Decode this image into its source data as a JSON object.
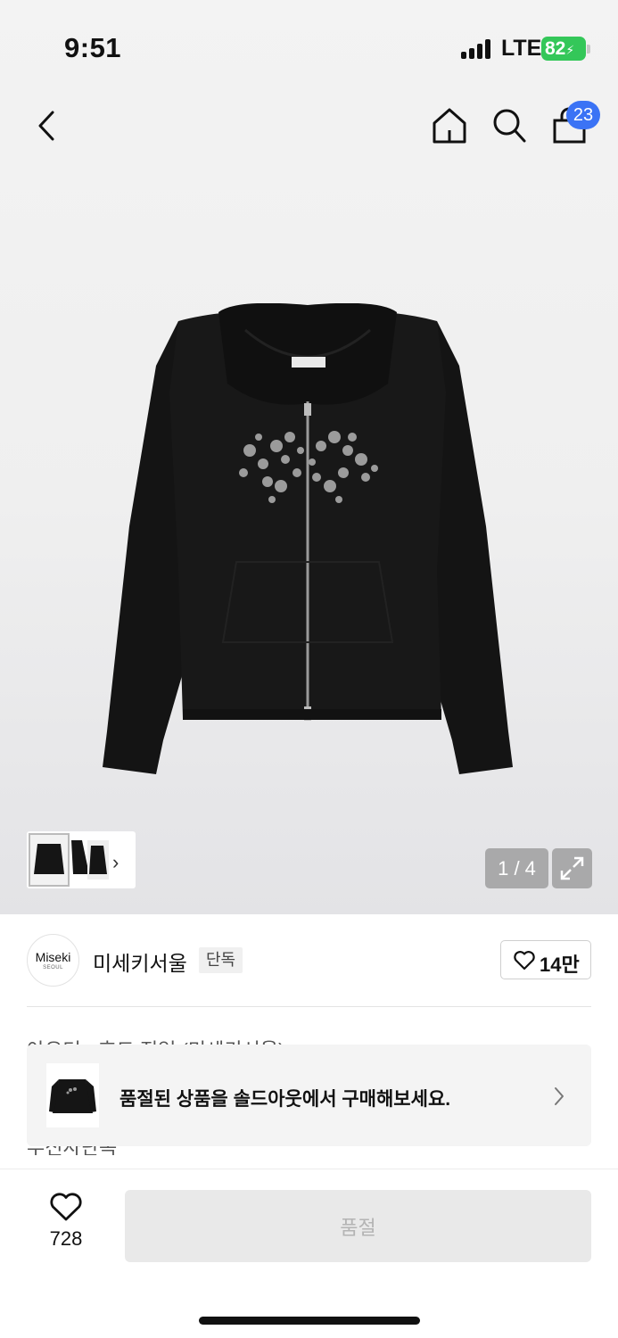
{
  "status_bar": {
    "time": "9:51",
    "network": "LTE",
    "battery": "82"
  },
  "nav": {
    "cart_count": "23"
  },
  "gallery": {
    "current_page": "1",
    "total_pages": "4",
    "counter_text": "1 / 4",
    "thumb_count": 3
  },
  "brand": {
    "logo_text": "Miseki",
    "logo_subtext": "SEOUL",
    "name": "미세키서울",
    "tag": "단독",
    "likes": "14만"
  },
  "product": {
    "title_partial": "아우터 · 후드 집업 (미세키서울)",
    "second_line_partial": "무신사단독"
  },
  "banner": {
    "text": "품절된 상품을 솔드아웃에서 구매해보세요."
  },
  "footer": {
    "wish_count": "728",
    "soldout_label": "품절"
  },
  "colors": {
    "accent": "#3b73f5",
    "battery": "#34c759",
    "hoodie": "#141414"
  }
}
